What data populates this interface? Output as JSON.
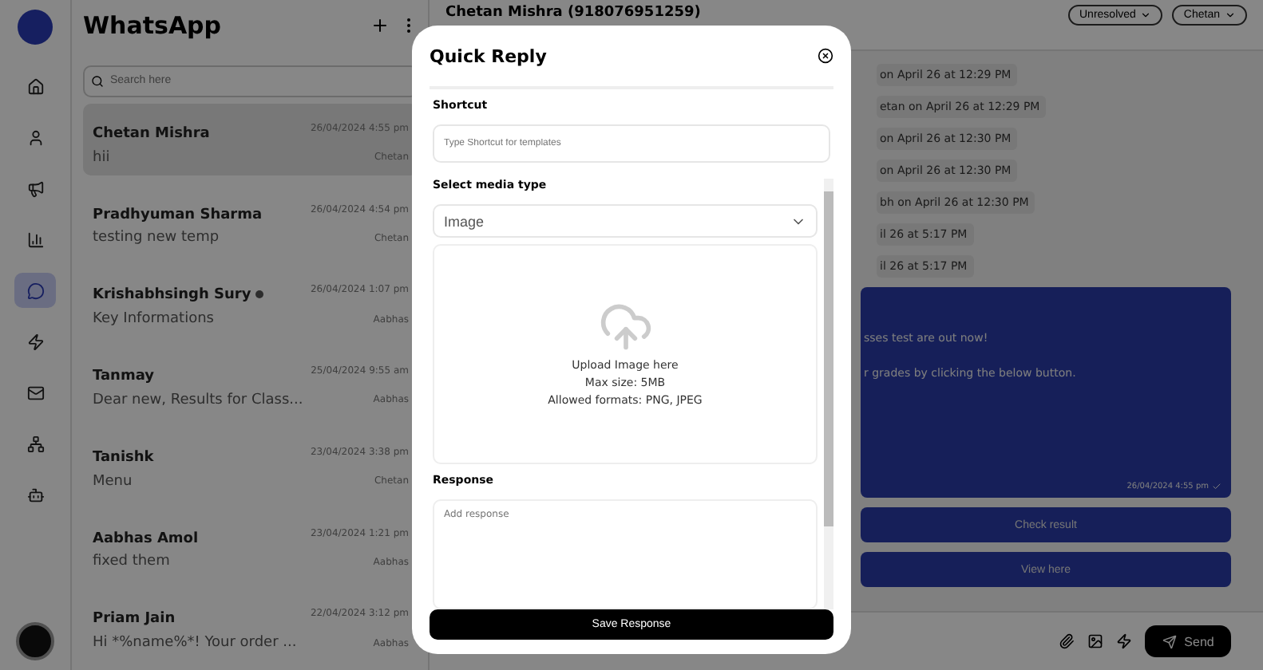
{
  "nav": {
    "items": [
      {
        "selected": false
      },
      {
        "selected": false
      },
      {
        "selected": false
      },
      {
        "selected": false
      },
      {
        "selected": true
      },
      {
        "selected": false
      },
      {
        "selected": false
      },
      {
        "selected": false
      },
      {
        "selected": false
      }
    ]
  },
  "chat_list": {
    "title": "WhatsApp",
    "search": {
      "placeholder": "Search here"
    },
    "chats": [
      {
        "name": "Chetan Mishra",
        "time": "26/04/2024 4:55 pm",
        "preview": "hii",
        "agent": "Chetan",
        "selected": true,
        "unread": false
      },
      {
        "name": "Pradhyuman Sharma",
        "time": "26/04/2024 4:54 pm",
        "preview": "testing new temp",
        "agent": "Chetan",
        "selected": false,
        "unread": false
      },
      {
        "name": "Krishabhsingh Sury",
        "time": "26/04/2024 1:07 pm",
        "preview": "Key Informations",
        "agent": "Aabhas",
        "selected": false,
        "unread": true
      },
      {
        "name": "Tanmay",
        "time": "25/04/2024 9:55 am",
        "preview": "Dear new, Results for Class...",
        "agent": "Aabhas",
        "selected": false,
        "unread": false
      },
      {
        "name": "Tanishk",
        "time": "23/04/2024 3:38 pm",
        "preview": "Menu",
        "agent": "Chetan",
        "selected": false,
        "unread": false
      },
      {
        "name": "Aabhas Amol",
        "time": "23/04/2024 1:21 pm",
        "preview": "fixed them",
        "agent": "Aabhas",
        "selected": false,
        "unread": false
      },
      {
        "name": "Priam Jain",
        "time": "22/04/2024 3:12 pm",
        "preview": "Hi *%name%*! Your order ...",
        "agent": "Aabhas",
        "selected": false,
        "unread": false
      }
    ]
  },
  "conversation": {
    "contact": "Chetan Mishra (918076951259)",
    "status": "Unresolved",
    "assignee": "Chetan",
    "events": [
      "on April 26 at 12:29 PM",
      "etan on April 26 at 12:29 PM",
      "on April 26 at 12:30 PM",
      "on April 26 at 12:30 PM",
      "bh on April 26 at 12:30 PM",
      "il 26 at 5:17 PM",
      "il 26 at 5:17 PM"
    ],
    "message": {
      "lines": [
        "sses test are out now!",
        "r grades by clicking the below button."
      ],
      "time": "26/04/2024 4:55 pm"
    },
    "buttons": [
      "Check result",
      "View here"
    ],
    "send": "Send"
  },
  "modal": {
    "title": "Quick Reply",
    "shortcut_label": "Shortcut",
    "shortcut_placeholder": "Type Shortcut for templates",
    "media_label": "Select media type",
    "media_value": "Image",
    "upload_lines": [
      "Upload Image here",
      "Max size: 5MB",
      "Allowed formats: PNG, JPEG"
    ],
    "response_label": "Response",
    "response_placeholder": "Add response",
    "save": "Save Response"
  }
}
